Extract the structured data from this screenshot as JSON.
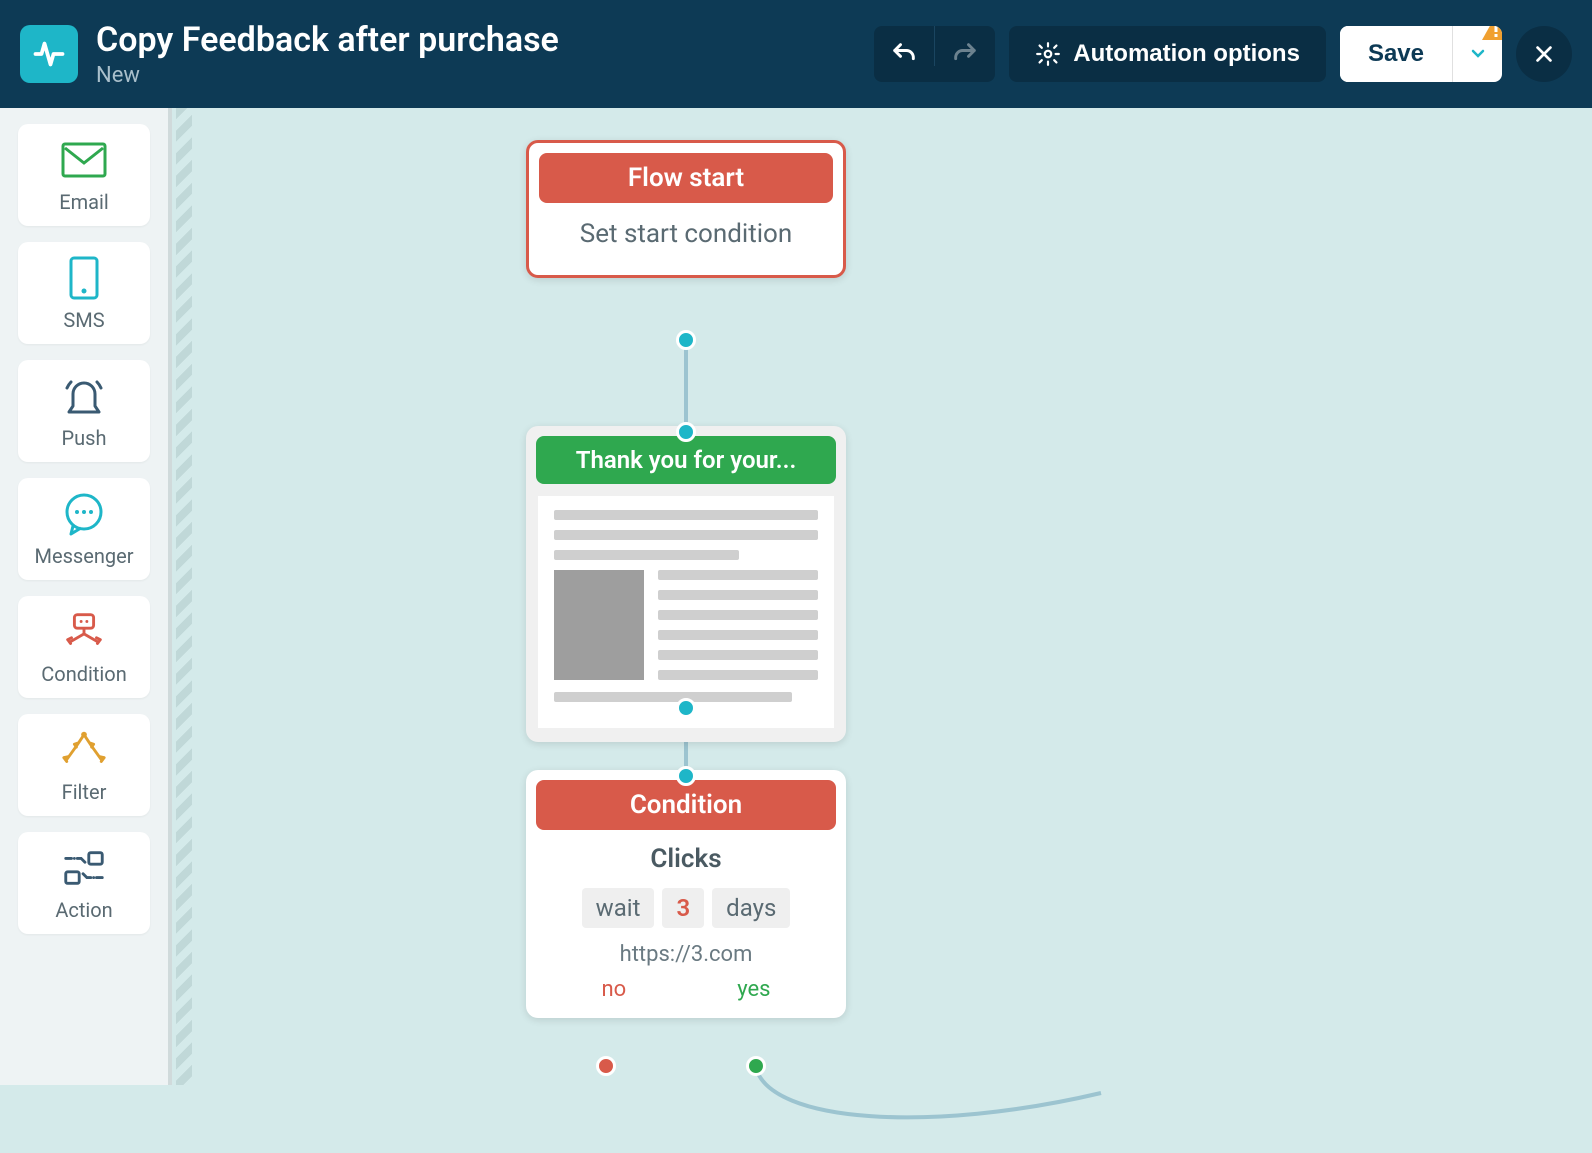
{
  "header": {
    "title": "Copy Feedback after purchase",
    "subtitle": "New",
    "options_label": "Automation options",
    "save_label": "Save"
  },
  "sidebar": {
    "items": [
      {
        "label": "Email"
      },
      {
        "label": "SMS"
      },
      {
        "label": "Push"
      },
      {
        "label": "Messenger"
      },
      {
        "label": "Condition"
      },
      {
        "label": "Filter"
      },
      {
        "label": "Action"
      }
    ]
  },
  "nodes": {
    "start": {
      "title": "Flow start",
      "body": "Set start condition"
    },
    "email": {
      "title": "Thank you for your..."
    },
    "condition": {
      "title": "Condition",
      "metric": "Clicks",
      "wait_prefix": "wait",
      "wait_value": "3",
      "wait_suffix": "days",
      "url": "https://3.com",
      "no_label": "no",
      "yes_label": "yes"
    }
  }
}
